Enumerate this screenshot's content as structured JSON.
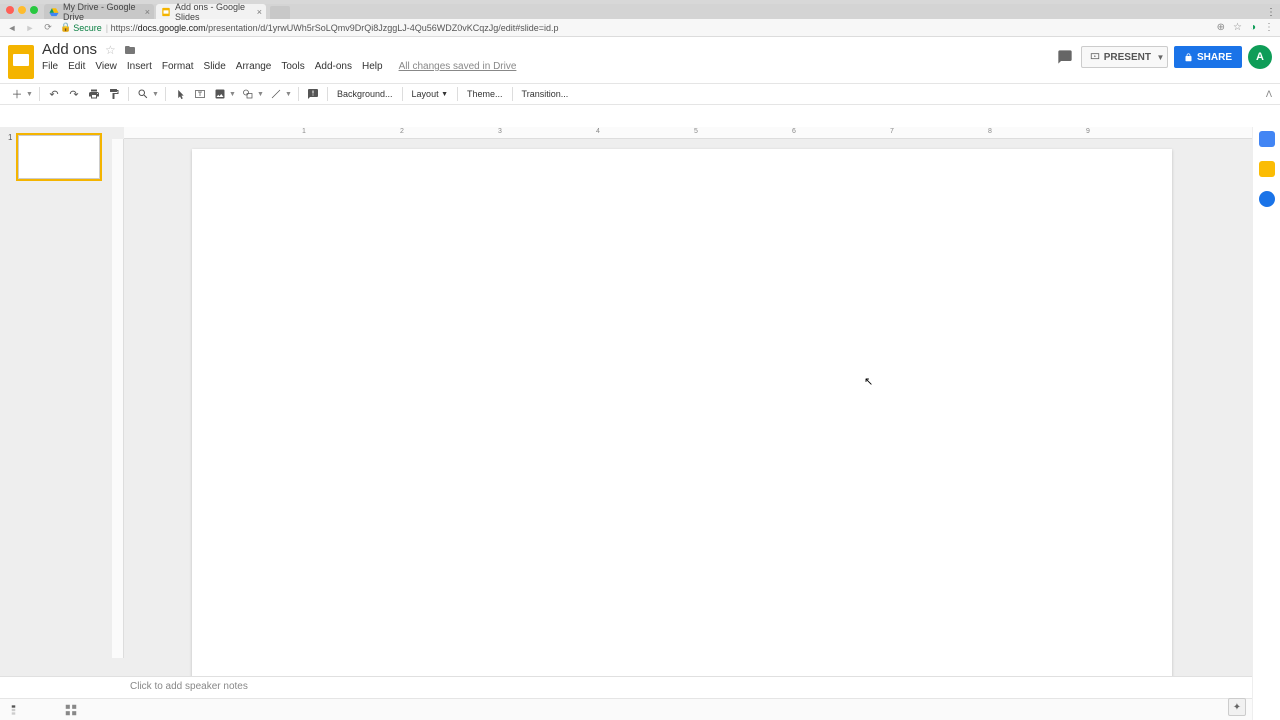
{
  "browser": {
    "tabs": [
      {
        "title": "My Drive - Google Drive",
        "active": false
      },
      {
        "title": "Add ons - Google Slides",
        "active": true
      }
    ],
    "secure_label": "Secure",
    "url_host": "docs.google.com",
    "url_path": "/presentation/d/1yrwUWh5rSoLQmv9DrQi8JzggLJ-4Qu56WDZ0vKCqzJg/edit#slide=id.p"
  },
  "doc": {
    "title": "Add ons",
    "save_status": "All changes saved in Drive",
    "avatar_initial": "A"
  },
  "menu": {
    "items": [
      "File",
      "Edit",
      "View",
      "Insert",
      "Format",
      "Slide",
      "Arrange",
      "Tools",
      "Add-ons",
      "Help"
    ]
  },
  "header_buttons": {
    "present": "PRESENT",
    "share": "SHARE"
  },
  "toolbar": {
    "background": "Background...",
    "layout": "Layout",
    "theme": "Theme...",
    "transition": "Transition..."
  },
  "ruler": {
    "labels": [
      "1",
      "2",
      "3",
      "4",
      "5",
      "6",
      "7",
      "8",
      "9"
    ]
  },
  "slide_panel": {
    "current": "1"
  },
  "notes": {
    "placeholder": "Click to add speaker notes"
  }
}
